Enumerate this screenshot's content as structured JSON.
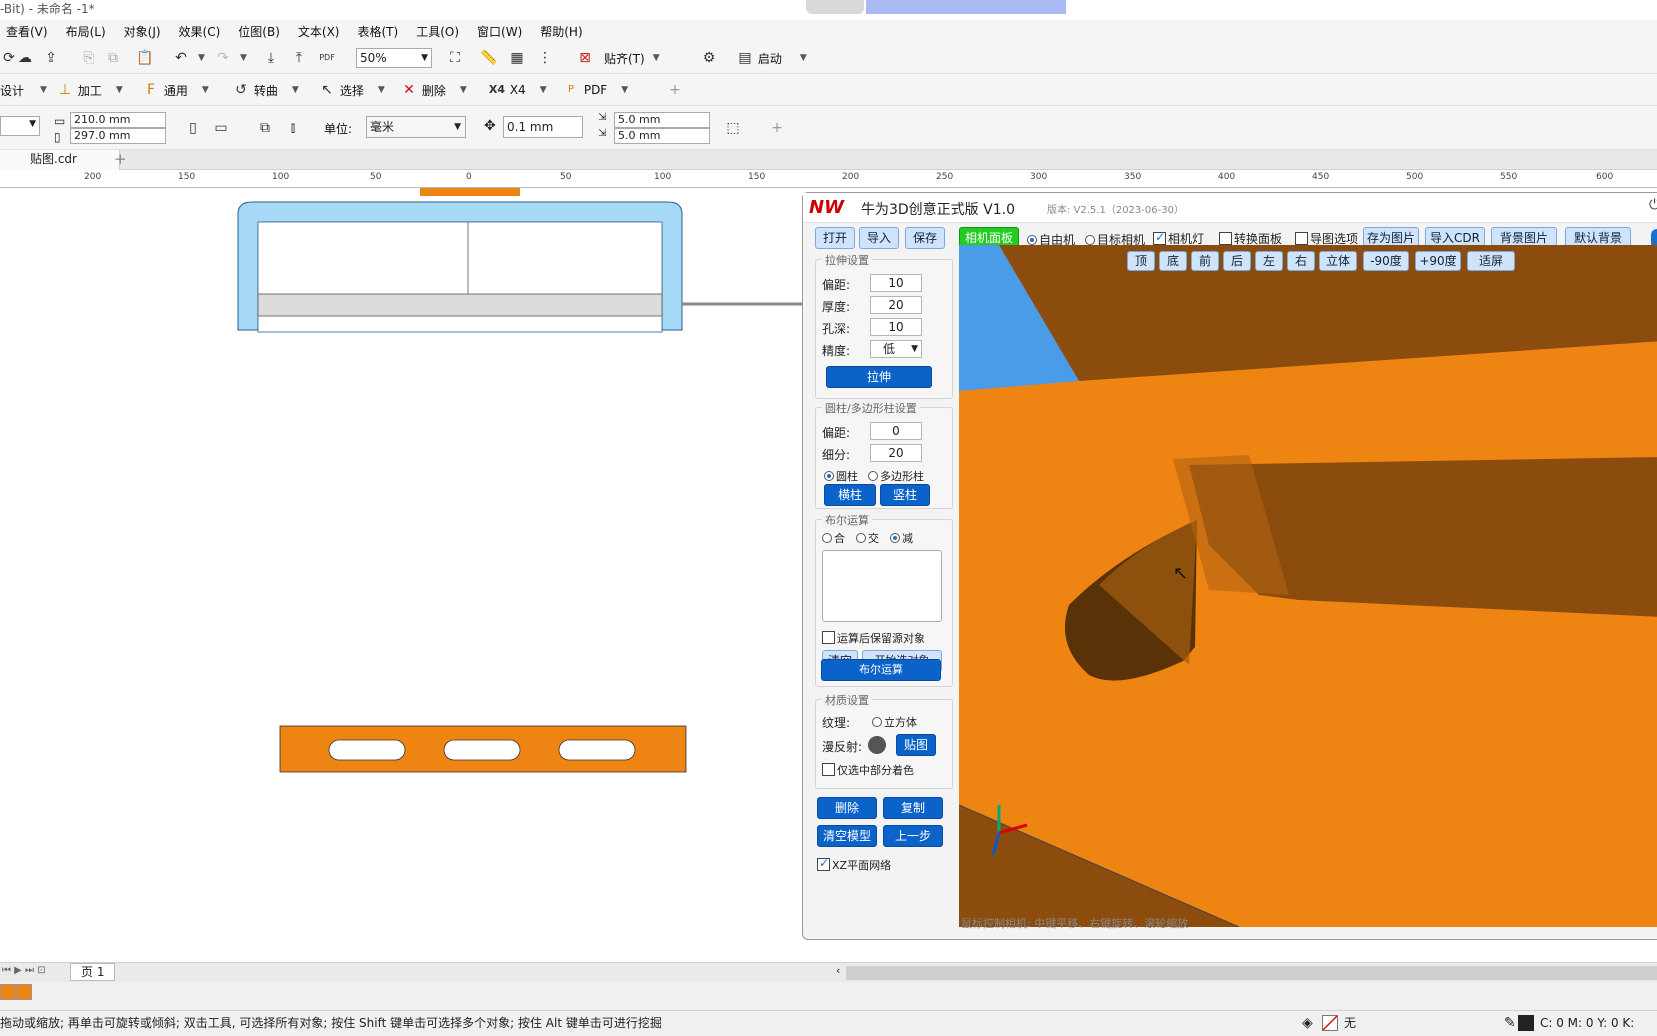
{
  "window": {
    "title": "-Bit) - 未命名 -1*"
  },
  "menu": [
    "查看(V)",
    "布局(L)",
    "对象(J)",
    "效果(C)",
    "位图(B)",
    "文本(X)",
    "表格(T)",
    "工具(O)",
    "窗口(W)",
    "帮助(H)"
  ],
  "toolbar1": {
    "zoom": "50%",
    "snap": "贴齐(T)",
    "launch": "启动"
  },
  "toolbar2": {
    "design": "设计",
    "process": "加工",
    "general": "通用",
    "curve": "转曲",
    "select": "选择",
    "delete": "删除",
    "x4": "X4",
    "pdf": "PDF"
  },
  "toolbar3": {
    "width": "210.0 mm",
    "height": "297.0 mm",
    "unit_label": "单位:",
    "unit": "毫米",
    "nudge": "0.1 mm",
    "dup_x": "5.0 mm",
    "dup_y": "5.0 mm"
  },
  "document": {
    "tab": "贴图.cdr"
  },
  "ruler": {
    "ticks": [
      "200",
      "150",
      "100",
      "50",
      "0",
      "50",
      "100",
      "150",
      "200",
      "250",
      "300",
      "350",
      "400",
      "450",
      "500",
      "550",
      "600"
    ]
  },
  "plugin": {
    "title": "牛为3D创意正式版 V1.0",
    "version": "版本: V2.5.1（2023-06-30）",
    "top_buttons": {
      "open": "打开",
      "import": "导入",
      "save": "保存",
      "camera_panel": "相机面板"
    },
    "camera_options": {
      "free": "自由机",
      "target": "目标相机",
      "light": "相机灯",
      "switch_panel": "转换面板",
      "map_options": "导图选项"
    },
    "right_buttons": {
      "save_image": "存为图片",
      "import_cdr": "导入CDR",
      "bg_image": "背景图片",
      "default_bg": "默认背景"
    },
    "extrude": {
      "legend": "拉伸设置",
      "offset_label": "偏距:",
      "offset": "10",
      "thickness_label": "厚度:",
      "thickness": "20",
      "hole_label": "孔深:",
      "hole": "10",
      "precision_label": "精度:",
      "precision": "低",
      "button": "拉伸"
    },
    "cylinder": {
      "legend": "圆柱/多边形柱设置",
      "offset_label": "偏距:",
      "offset": "0",
      "subdiv_label": "细分:",
      "subdiv": "20",
      "cyl": "圆柱",
      "poly": "多边形柱",
      "h_btn": "横柱",
      "v_btn": "竖柱"
    },
    "boolean": {
      "legend": "布尔运算",
      "union": "合",
      "intersect": "交",
      "subtract": "减",
      "keep_src": "运算后保留源对象",
      "clear": "清空",
      "start_select": "开始选对象",
      "run": "布尔运算"
    },
    "material": {
      "legend": "材质设置",
      "texture_label": "纹理:",
      "cube": "立方体",
      "diffuse_label": "漫反射:",
      "map_btn": "贴图",
      "partial": "仅选中部分着色"
    },
    "bottom_buttons": {
      "delete": "删除",
      "copy": "复制",
      "clear_model": "清空模型",
      "undo": "上一步"
    },
    "xz_grid": "XZ平面网络",
    "view_buttons": [
      "顶",
      "底",
      "前",
      "后",
      "左",
      "右",
      "立体",
      "-90度",
      "+90度",
      "适屏"
    ],
    "hint": "鼠标控制相机: 中键平移、右键旋转、滚轮缩放",
    "colors": {
      "model": "#ee8412",
      "model_dark": "#8b4c0e",
      "sky": "#4a9ce8",
      "btn": "#2f7fd6",
      "green": "#22cc22"
    }
  },
  "page": {
    "tab": "页 1"
  },
  "status": {
    "text": "拖动或缩放; 再单击可旋转或倾斜; 双击工具, 可选择所有对象; 按住 Shift 键单击可选择多个对象; 按住 Alt 键单击可进行挖掘",
    "fill": "无",
    "cmyk": "C: 0 M: 0 Y: 0 K:"
  }
}
